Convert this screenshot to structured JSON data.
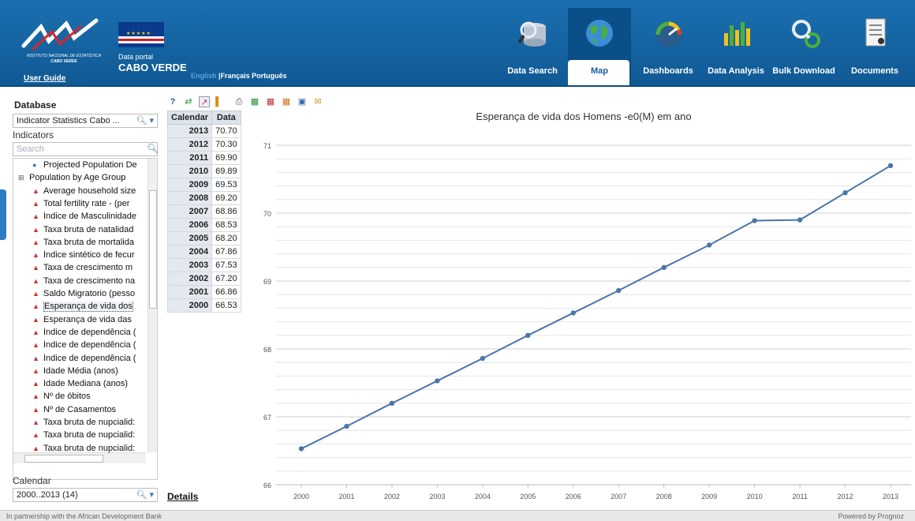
{
  "header": {
    "logo_line1": "INSTITUTO NACIONAL DE ESTATÍSTICA",
    "logo_line2": "CABO VERDE",
    "user_guide": "User Guide",
    "portal_line1": "Data portal",
    "portal_line2": "CABO VERDE",
    "languages": [
      {
        "label": "English",
        "active": true
      },
      {
        "label": "Français",
        "active": false
      },
      {
        "label": "Português",
        "active": false
      }
    ],
    "nav": [
      {
        "label": "Data Search",
        "icon": "database-search-icon"
      },
      {
        "label": "Map",
        "icon": "globe-icon"
      },
      {
        "label": "Dashboards",
        "icon": "gauge-icon"
      },
      {
        "label": "Data Analysis",
        "icon": "bar-chart-icon"
      },
      {
        "label": "Bulk Download",
        "icon": "magnifier-icon"
      },
      {
        "label": "Documents",
        "icon": "document-icon"
      }
    ]
  },
  "sidebar": {
    "database_title": "Database",
    "database_value": "Indicator Statistics Cabo ...",
    "indicators_title": "Indicators",
    "search_placeholder": "Search",
    "tree": [
      {
        "label": "Projected Population De",
        "type": "globe"
      },
      {
        "label": "Population by Age Group",
        "type": "group"
      },
      {
        "label": "Average household size",
        "type": "leaf"
      },
      {
        "label": "Total fertility rate - (per",
        "type": "leaf"
      },
      {
        "label": "Índice de Masculinidade",
        "type": "leaf"
      },
      {
        "label": "Taxa bruta de natalidad",
        "type": "leaf"
      },
      {
        "label": "Taxa bruta de mortalida",
        "type": "leaf"
      },
      {
        "label": "Índice sintético de fecur",
        "type": "leaf"
      },
      {
        "label": "Taxa de crescimento m",
        "type": "leaf"
      },
      {
        "label": "Taxa de crescimento na",
        "type": "leaf"
      },
      {
        "label": "Saldo Migratorio (pesso",
        "type": "leaf"
      },
      {
        "label": "Esperança de vida dos",
        "type": "leaf",
        "selected": true
      },
      {
        "label": "Esperança de vida das",
        "type": "leaf"
      },
      {
        "label": "Índice de dependência (",
        "type": "leaf"
      },
      {
        "label": "Índice de dependência (",
        "type": "leaf"
      },
      {
        "label": "Índice de dependência (",
        "type": "leaf"
      },
      {
        "label": "Idade Média (anos)",
        "type": "leaf"
      },
      {
        "label": "Idade Mediana (anos)",
        "type": "leaf"
      },
      {
        "label": "Nº de óbitos",
        "type": "leaf"
      },
      {
        "label": "Nº de Casamentos",
        "type": "leaf"
      },
      {
        "label": "Taxa bruta de nupcialid:",
        "type": "leaf"
      },
      {
        "label": "Taxa bruta de nupcialid:",
        "type": "leaf"
      },
      {
        "label": "Taxa bruta de nupcialid:",
        "type": "leaf"
      }
    ],
    "calendar_title": "Calendar",
    "calendar_value": "2000..2013 (14)"
  },
  "toolbar": {
    "icons": [
      "help-icon",
      "refresh-icon",
      "line-chart-icon",
      "bar-chart-icon",
      "print-icon",
      "excel-icon",
      "pdf-icon",
      "csv-icon",
      "image-icon",
      "email-icon"
    ]
  },
  "table": {
    "headers": [
      "Calendar",
      "Data"
    ],
    "rows": [
      [
        "2013",
        "70.70"
      ],
      [
        "2012",
        "70.30"
      ],
      [
        "2011",
        "69.90"
      ],
      [
        "2010",
        "69.89"
      ],
      [
        "2009",
        "69.53"
      ],
      [
        "2008",
        "69.20"
      ],
      [
        "2007",
        "68.86"
      ],
      [
        "2006",
        "68.53"
      ],
      [
        "2005",
        "68.20"
      ],
      [
        "2004",
        "67.86"
      ],
      [
        "2003",
        "67.53"
      ],
      [
        "2002",
        "67.20"
      ],
      [
        "2001",
        "66.86"
      ],
      [
        "2000",
        "66.53"
      ]
    ]
  },
  "details_link": "Details",
  "chart_data": {
    "type": "line",
    "title": "Esperança de vida dos Homens -e0(M) em ano",
    "x": [
      "2000",
      "2001",
      "2002",
      "2003",
      "2004",
      "2005",
      "2006",
      "2007",
      "2008",
      "2009",
      "2010",
      "2011",
      "2012",
      "2013"
    ],
    "series": [
      {
        "values": [
          66.53,
          66.86,
          67.2,
          67.53,
          67.86,
          68.2,
          68.53,
          68.86,
          69.2,
          69.53,
          69.89,
          69.9,
          70.3,
          70.7
        ]
      }
    ],
    "ylim": [
      66,
      71
    ],
    "yticks": [
      66,
      67,
      68,
      69,
      70,
      71
    ],
    "xlabel": "",
    "ylabel": "",
    "grid": true,
    "line_color": "#4a76a8"
  },
  "footer": {
    "left": "In partnership with the African Development Bank",
    "right": "Powered by Prognoz"
  }
}
